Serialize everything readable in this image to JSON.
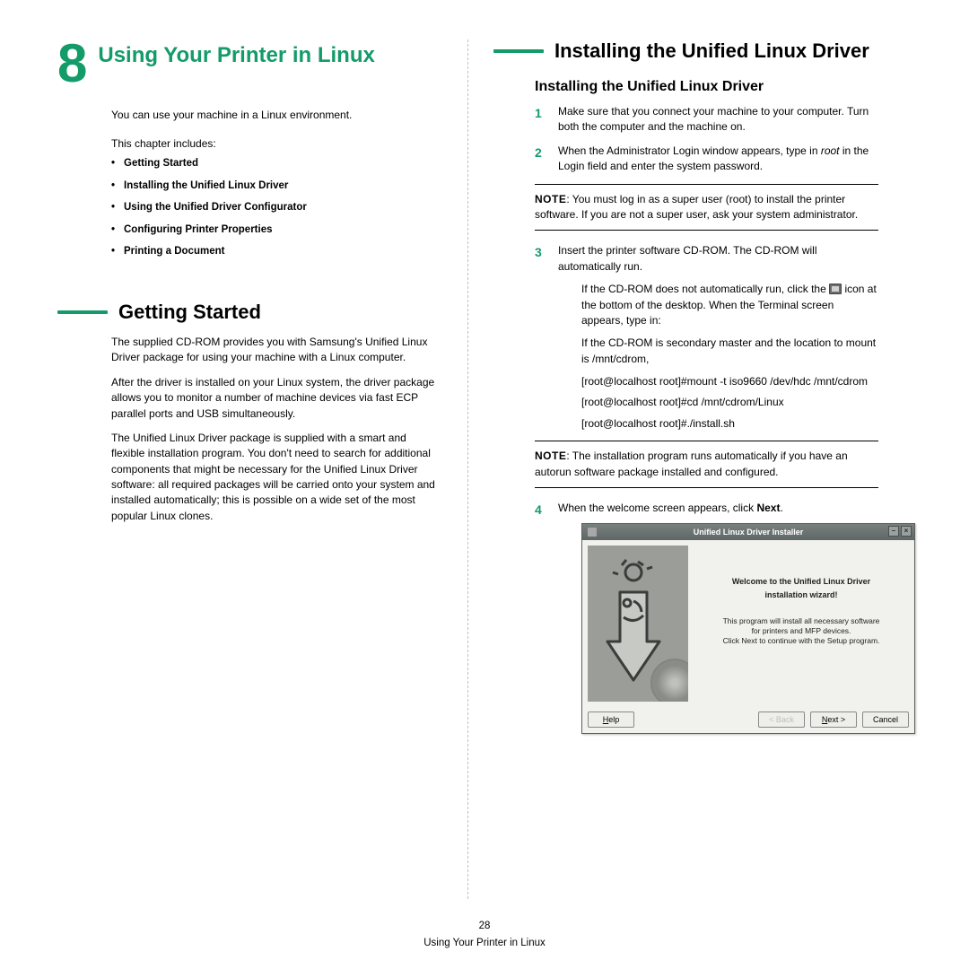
{
  "chapter": {
    "number": "8",
    "title": "Using Your Printer in Linux",
    "intro": "You can use your machine in a Linux environment.",
    "includes_label": "This chapter includes:",
    "toc": [
      "Getting Started",
      "Installing the Unified Linux Driver",
      "Using the Unified Driver Configurator",
      "Configuring Printer Properties",
      "Printing a Document"
    ]
  },
  "getting_started": {
    "heading": "Getting Started",
    "p1": "The supplied CD-ROM provides you with Samsung's Unified Linux Driver package for using your machine with a Linux computer.",
    "p2": "After the driver is installed on your Linux system, the driver package allows you to monitor a number of machine devices via fast ECP parallel ports and USB simultaneously.",
    "p3": "The Unified Linux Driver package is supplied with a smart and flexible installation program. You don't need to search for additional components that might be necessary for the Unified Linux Driver software: all required packages will be carried onto your system and installed automatically; this is possible on a wide set of the most popular Linux clones."
  },
  "install": {
    "heading": "Installing the Unified Linux Driver",
    "subheading": "Installing the Unified Linux Driver",
    "step1": "Make sure that you connect your machine to your computer. Turn both the computer and the machine on.",
    "step2_a": "When the Administrator Login window appears, type in ",
    "step2_em": "root",
    "step2_b": " in the Login field and enter the system password.",
    "note1_label": "NOTE",
    "note1_text": ": You must log in as a super user (root) to install the printer software. If you are not a super user, ask your system administrator.",
    "step3": "Insert the printer software CD-ROM. The CD-ROM will automatically run.",
    "sub3a_a": "If the CD-ROM does not automatically run, click the ",
    "sub3a_b": " icon at the bottom of the desktop. When the Terminal screen appears, type in:",
    "sub3b": "If the CD-ROM is secondary master and the location to mount is /mnt/cdrom,",
    "cmd1": "[root@localhost root]#mount -t iso9660 /dev/hdc /mnt/cdrom",
    "cmd2": "[root@localhost root]#cd /mnt/cdrom/Linux",
    "cmd3": "[root@localhost root]#./install.sh",
    "note2_label": "NOTE",
    "note2_text": ": The installation program runs automatically if you have an autorun software package installed and configured.",
    "step4_a": "When the welcome screen appears, click ",
    "step4_b": "Next",
    "step4_c": "."
  },
  "installer": {
    "title": "Unified Linux Driver Installer",
    "welcome1": "Welcome to the Unified Linux Driver",
    "welcome2": "installation wizard!",
    "body1": "This program will install all necessary software",
    "body2": "for printers and MFP devices.",
    "body3": "Click Next to continue with the Setup program.",
    "help": "Help",
    "back": "< Back",
    "next": "Next >",
    "cancel": "Cancel"
  },
  "footer": {
    "page_number": "28",
    "running_title": "Using Your Printer in Linux"
  }
}
